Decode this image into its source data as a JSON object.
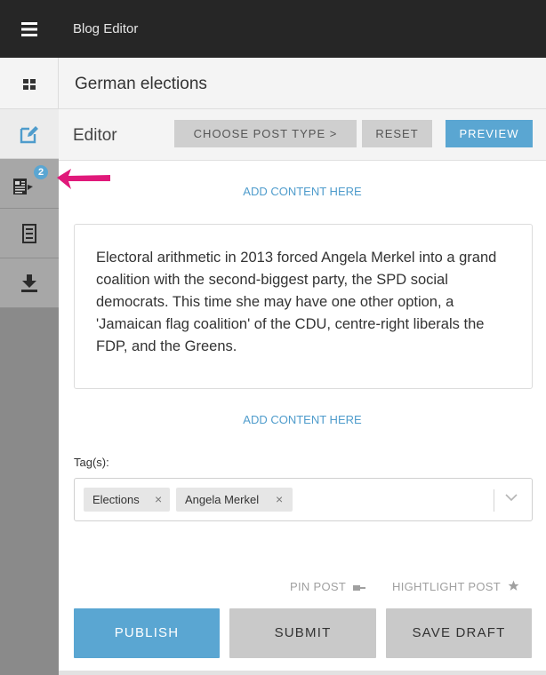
{
  "app": {
    "title": "Blog Editor"
  },
  "sidebar": {
    "items": [
      {
        "icon": "menu-icon"
      },
      {
        "icon": "grid-icon"
      },
      {
        "icon": "edit-icon",
        "active": true
      },
      {
        "icon": "posts-icon",
        "badge": "2"
      },
      {
        "icon": "archive-icon"
      },
      {
        "icon": "download-icon"
      }
    ]
  },
  "page": {
    "title": "German elections"
  },
  "editor": {
    "label": "Editor",
    "choose_post_type": "CHOOSE POST TYPE  >",
    "reset": "RESET",
    "preview": "PREVIEW"
  },
  "content": {
    "add_content_top": "ADD CONTENT HERE",
    "text_block": "Electoral arithmetic in 2013 forced Angela Merkel into a grand coalition with the second-biggest party, the SPD social democrats. This time she may have one other option, a 'Jamaican flag coalition' of the CDU, centre-right liberals the FDP, and the Greens.",
    "add_content_bottom": "ADD CONTENT HERE"
  },
  "tags": {
    "label": "Tag(s):",
    "items": [
      "Elections",
      "Angela Merkel"
    ],
    "remove_glyph": "×"
  },
  "options": {
    "pin_post": "PIN POST",
    "highlight_post": "HIGHTLIGHT POST"
  },
  "actions": {
    "publish": "PUBLISH",
    "submit": "SUBMIT",
    "save_draft": "SAVE DRAFT"
  },
  "colors": {
    "accent": "#5aa6d2",
    "pointer_arrow": "#e0197a",
    "topbar": "#262626"
  }
}
